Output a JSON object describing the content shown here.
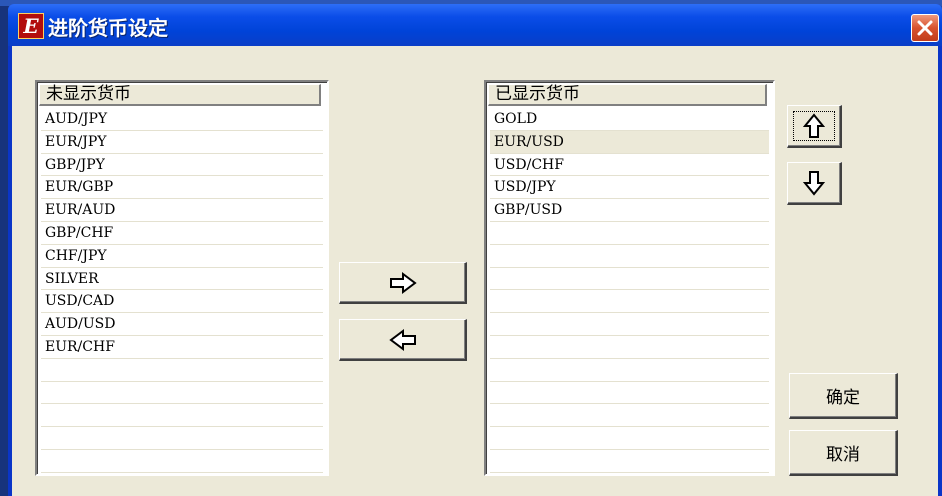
{
  "window": {
    "title": "进阶货币设定",
    "app_icon_letter": "E"
  },
  "hidden_list": {
    "header": "未显示货币",
    "items": [
      "AUD/JPY",
      "EUR/JPY",
      "GBP/JPY",
      "EUR/GBP",
      "EUR/AUD",
      "GBP/CHF",
      "CHF/JPY",
      "SILVER",
      "USD/CAD",
      "AUD/USD",
      "EUR/CHF"
    ]
  },
  "shown_list": {
    "header": "已显示货币",
    "items": [
      "GOLD",
      "EUR/USD",
      "USD/CHF",
      "USD/JPY",
      "GBP/USD"
    ],
    "selected_index": 1
  },
  "buttons": {
    "ok_label": "确定",
    "cancel_label": "取消"
  },
  "icons": {
    "add": "arrow-right-icon",
    "remove": "arrow-left-icon",
    "move_up": "arrow-up-icon",
    "move_down": "arrow-down-icon",
    "close": "close-icon"
  }
}
